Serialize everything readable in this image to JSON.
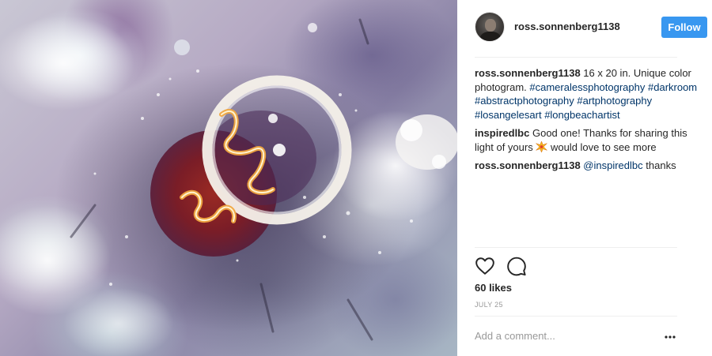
{
  "post": {
    "image_alt": "abstract camera-less photogram",
    "author": {
      "username": "ross.sonnenberg1138"
    },
    "follow_label": "Follow",
    "accent_color": "#3897f0",
    "caption": {
      "username": "ross.sonnenberg1138",
      "text": "16 x 20 in. Unique color photogram.",
      "hashtags": [
        "#cameralessphotography",
        "#darkroom",
        "#abstractphotography",
        "#artphotography",
        "#losangelesart",
        "#longbeachartist"
      ]
    },
    "comments": [
      {
        "username": "inspiredlbc",
        "text_before": "Good one! Thanks for sharing this light of yours",
        "emoji": "sparkle-burst-icon",
        "text_after": "would love to see more"
      },
      {
        "username": "ross.sonnenberg1138",
        "mention": "@inspiredlbc",
        "text": "thanks"
      }
    ],
    "likes": "60 likes",
    "date": "JULY 25",
    "add_comment_placeholder": "Add a comment...",
    "icons": {
      "like": "heart-icon",
      "comment": "speech-bubble-icon",
      "options": "more-options-icon"
    }
  }
}
